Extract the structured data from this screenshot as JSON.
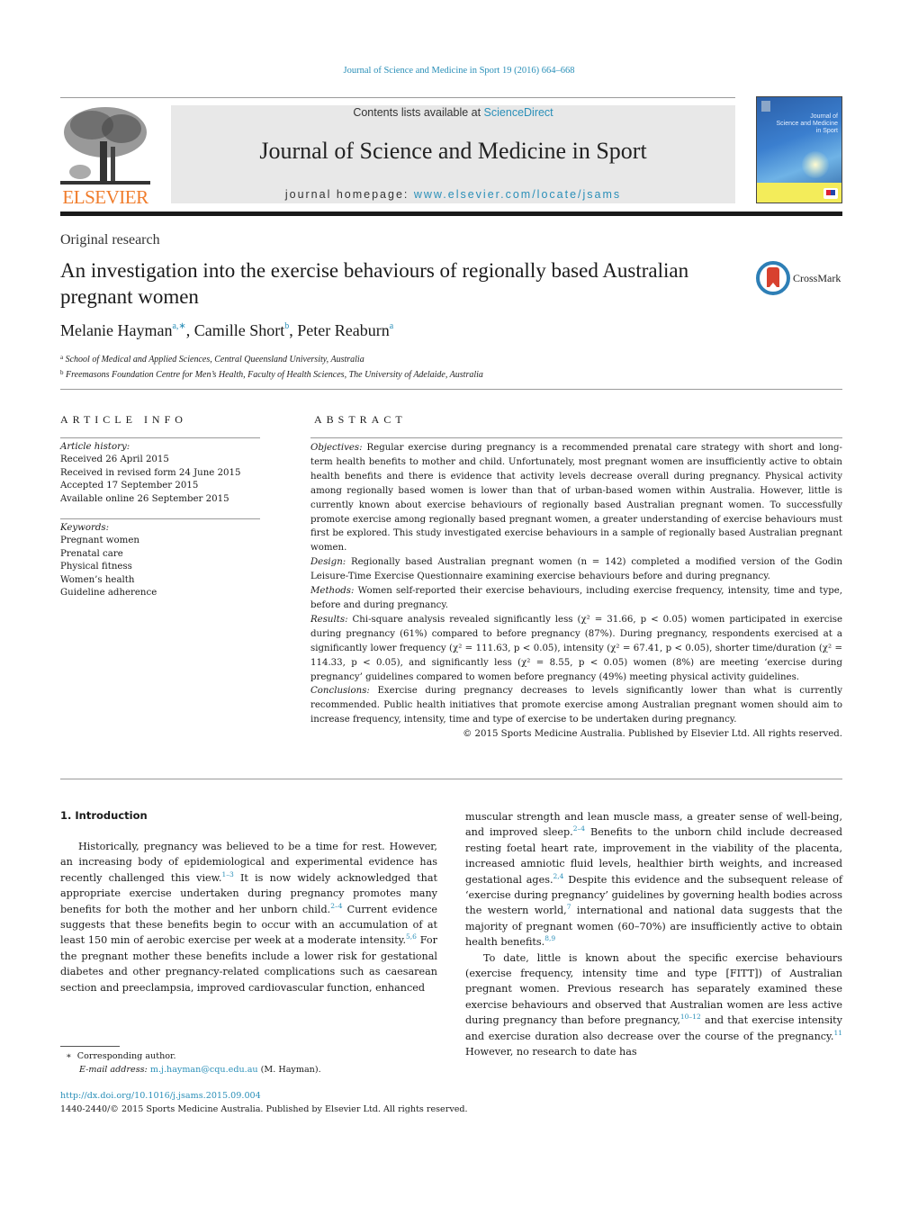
{
  "running_head": "Journal of Science and Medicine in Sport 19 (2016) 664–668",
  "masthead": {
    "publisher_logo_text": "ELSEVIER",
    "contents_prefix": "Contents lists available at ",
    "contents_link": "ScienceDirect",
    "journal_name": "Journal of Science and Medicine in Sport",
    "homepage_prefix": "journal homepage: ",
    "homepage_link": "www.elsevier.com/locate/jsams",
    "cover_title_lines": [
      "Journal of",
      "Science and Medicine",
      "in Sport"
    ],
    "colors": {
      "link": "#2a8fb8",
      "elsevier_orange": "#f07c2b",
      "banner_bg": "#e8e8e8"
    }
  },
  "article": {
    "section_type": "Original research",
    "title": "An investigation into the exercise behaviours of regionally based Australian pregnant women",
    "crossmark_label": "CrossMark",
    "authors": [
      {
        "name": "Melanie Hayman",
        "sup": "a,∗"
      },
      {
        "name": "Camille Short",
        "sup": "b"
      },
      {
        "name": "Peter Reaburn",
        "sup": "a"
      }
    ],
    "affiliations": [
      {
        "sup": "a",
        "text": "School of Medical and Applied Sciences, Central Queensland University, Australia"
      },
      {
        "sup": "b",
        "text": "Freemasons Foundation Centre for Men’s Health, Faculty of Health Sciences, The University of Adelaide, Australia"
      }
    ]
  },
  "article_info": {
    "heading": "ARTICLE INFO",
    "history_label": "Article history:",
    "history": [
      "Received 26 April 2015",
      "Received in revised form 24 June 2015",
      "Accepted 17 September 2015",
      "Available online 26 September 2015"
    ],
    "keywords_label": "Keywords:",
    "keywords": [
      "Pregnant women",
      "Prenatal care",
      "Physical fitness",
      "Women’s health",
      "Guideline adherence"
    ]
  },
  "abstract": {
    "heading": "ABSTRACT",
    "sections": [
      {
        "label": "Objectives:",
        "text": " Regular exercise during pregnancy is a recommended prenatal care strategy with short and long-term health benefits to mother and child. Unfortunately, most pregnant women are insufficiently active to obtain health benefits and there is evidence that activity levels decrease overall during pregnancy. Physical activity among regionally based women is lower than that of urban-based women within Australia. However, little is currently known about exercise behaviours of regionally based Australian pregnant women. To successfully promote exercise among regionally based pregnant women, a greater understanding of exercise behaviours must first be explored. This study investigated exercise behaviours in a sample of regionally based Australian pregnant women."
      },
      {
        "label": "Design:",
        "text": " Regionally based Australian pregnant women (n = 142) completed a modified version of the Godin Leisure-Time Exercise Questionnaire examining exercise behaviours before and during pregnancy."
      },
      {
        "label": "Methods:",
        "text": " Women self-reported their exercise behaviours, including exercise frequency, intensity, time and type, before and during pregnancy."
      },
      {
        "label": "Results:",
        "text": " Chi-square analysis revealed significantly less (χ² = 31.66, p < 0.05) women participated in exercise during pregnancy (61%) compared to before pregnancy (87%). During pregnancy, respondents exercised at a significantly lower frequency (χ² = 111.63, p < 0.05), intensity (χ² = 67.41, p < 0.05), shorter time/duration (χ² = 114.33, p < 0.05), and significantly less (χ² = 8.55, p < 0.05) women (8%) are meeting ‘exercise during pregnancy’ guidelines compared to women before pregnancy (49%) meeting physical activity guidelines."
      },
      {
        "label": "Conclusions:",
        "text": " Exercise during pregnancy decreases to levels significantly lower than what is currently recommended. Public health initiatives that promote exercise among Australian pregnant women should aim to increase frequency, intensity, time and type of exercise to be undertaken during pregnancy."
      }
    ],
    "copyright": "© 2015 Sports Medicine Australia. Published by Elsevier Ltd. All rights reserved."
  },
  "body": {
    "section_heading": "1.  Introduction",
    "left_paragraph": [
      {
        "t": "Historically, pregnancy was believed to be a time for rest. However, an increasing body of epidemiological and experimental evidence has recently challenged this view."
      },
      {
        "ref": "1–3"
      },
      {
        "t": " It is now widely acknowledged that appropriate exercise undertaken during pregnancy promotes many benefits for both the mother and her unborn child."
      },
      {
        "ref": "2–4"
      },
      {
        "t": " Current evidence suggests that these benefits begin to occur with an accumulation of at least 150 min of aerobic exercise per week at a moderate intensity."
      },
      {
        "ref": "5,6"
      },
      {
        "t": " For the pregnant mother these benefits include a lower risk for gestational diabetes and other pregnancy-related complications such as caesarean section and preeclampsia, improved cardiovascular function, enhanced"
      }
    ],
    "right_paragraph_1": [
      {
        "t": "muscular strength and lean muscle mass, a greater sense of well-being, and improved sleep."
      },
      {
        "ref": "2–4"
      },
      {
        "t": " Benefits to the unborn child include decreased resting foetal heart rate, improvement in the viability of the placenta, increased amniotic fluid levels, healthier birth weights, and increased gestational ages."
      },
      {
        "ref": "2,4"
      },
      {
        "t": " Despite this evidence and the subsequent release of ‘exercise during pregnancy’ guidelines by governing health bodies across the western world,"
      },
      {
        "ref": "7"
      },
      {
        "t": " international and national data suggests that the majority of pregnant women (60–70%) are insufficiently active to obtain health benefits."
      },
      {
        "ref": "8,9"
      }
    ],
    "right_paragraph_2": [
      {
        "t": "To date, little is known about the specific exercise behaviours (exercise frequency, intensity time and type [FITT]) of Australian pregnant women. Previous research has separately examined these exercise behaviours and observed that Australian women are less active during pregnancy than before pregnancy,"
      },
      {
        "ref": "10–12"
      },
      {
        "t": " and that exercise intensity and exercise duration also decrease over the course of the pregnancy."
      },
      {
        "ref": "11"
      },
      {
        "t": " However, no research to date has"
      }
    ]
  },
  "footnote": {
    "marker": "∗",
    "corresponding": "Corresponding author.",
    "email_label": "E-mail address:",
    "email": "m.j.hayman@cqu.edu.au",
    "email_suffix": " (M. Hayman)."
  },
  "footer": {
    "doi": "http://dx.doi.org/10.1016/j.jsams.2015.09.004",
    "issn_copyright": "1440-2440/© 2015 Sports Medicine Australia. Published by Elsevier Ltd. All rights reserved."
  }
}
